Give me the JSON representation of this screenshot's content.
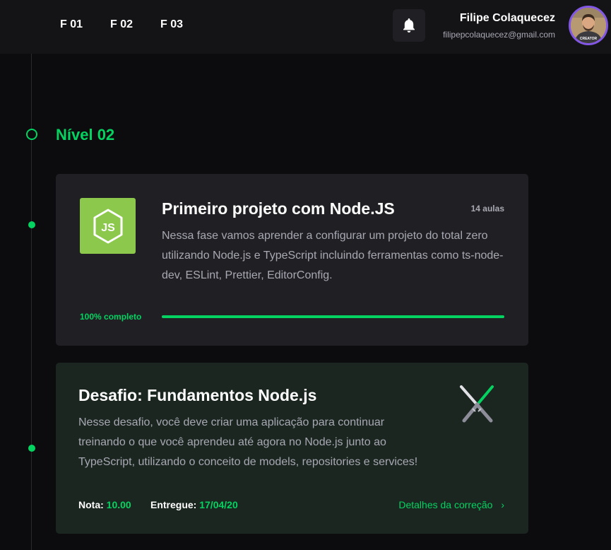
{
  "header": {
    "nav": [
      "F 01",
      "F 02",
      "F 03"
    ],
    "user": {
      "name": "Filipe Colaquecez",
      "email": "filipepcolaquecez@gmail.com",
      "avatar_shirt_text": "CREATOR"
    }
  },
  "level": {
    "title": "Nível 02"
  },
  "course_card": {
    "title": "Primeiro projeto com Node.JS",
    "lessons": "14 aulas",
    "description": "Nessa fase vamos aprender a configurar um projeto do total zero utilizando Node.js e TypeScript incluindo ferramentas como ts-node-dev, ESLint, Prettier, EditorConfig.",
    "progress_label": "100% completo",
    "progress_value": 1.0,
    "logo_icon": "nodejs-logo-icon",
    "logo_color": "#8cc84b"
  },
  "challenge_card": {
    "title": "Desafio: Fundamentos Node.js",
    "description": "Nesse desafio, você deve criar uma aplicação para continuar treinando o que você aprendeu até agora no Node.js junto ao TypeScript, utilizando o conceito de models, repositories e services!",
    "grade_label": "Nota:",
    "grade_value": "10.00",
    "delivered_label": "Entregue:",
    "delivered_value": "17/04/20",
    "details_link": "Detalhes da correção",
    "icon": "crossed-lightsabers-icon"
  },
  "colors": {
    "accent": "#04d361",
    "background": "#0c0c0e",
    "header_bg": "#141417",
    "card_bg": "#202024",
    "challenge_bg": "#1b2620",
    "avatar_border": "#8257e5"
  }
}
